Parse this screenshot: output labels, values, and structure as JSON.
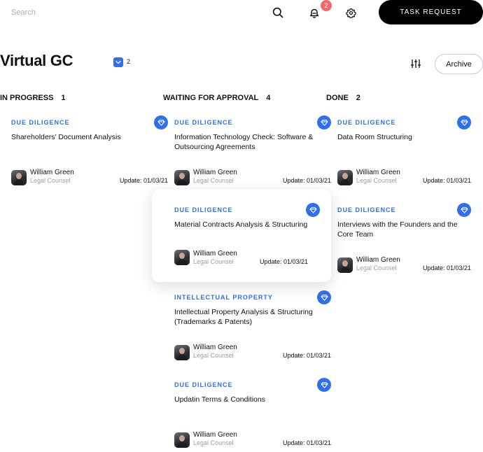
{
  "search": {
    "placeholder": "Search"
  },
  "header": {
    "notification_count": "2",
    "task_request_label": "TASK REQUEST"
  },
  "page": {
    "title": "Virtual GC",
    "selected_count": "2",
    "archive_label": "Archive"
  },
  "columns": [
    {
      "title": "IN PROGRESS",
      "count": "1",
      "cards": [
        {
          "category": "DUE DILIGENCE",
          "title": "Shareholders’ Document Analysis",
          "person": "William Green",
          "role": "Legal Counsel",
          "update": "Update: 01/03/21"
        }
      ]
    },
    {
      "title": "WAITING FOR APPROVAL",
      "count": "4",
      "cards": [
        {
          "category": "DUE DILIGENCE",
          "title": "Information Technology Check: Software & Outsourcing Agreements",
          "person": "William Green",
          "role": "Legal Counsel",
          "update": "Update: 01/03/21"
        },
        {
          "category": "DUE DILIGENCE",
          "title": "Material Contracts Analysis & Structuring",
          "person": "William Green",
          "role": "Legal Counsel",
          "update": "Update: 01/03/21"
        },
        {
          "category": "INTELLECTUAL PROPERTY",
          "title": "Intellectual Property Analysis & Structuring (Trademarks & Patents)",
          "person": "William Green",
          "role": "Legal Counsel",
          "update": "Update: 01/03/21"
        },
        {
          "category": "DUE DILIGENCE",
          "title": "Updatin Terms & Conditions",
          "person": "William Green",
          "role": "Legal Counsel",
          "update": "Update: 01/03/21"
        }
      ]
    },
    {
      "title": "DONE",
      "count": "2",
      "cards": [
        {
          "category": "DUE DILIGENCE",
          "title": "Data Room Structuring",
          "person": "William Green",
          "role": "Legal Counsel",
          "update": "Update: 01/03/21"
        },
        {
          "category": "DUE DILIGENCE",
          "title": "Interviews with the Founders and the Core Team",
          "person": "William Green",
          "role": "Legal Counsel",
          "update": "Update: 01/03/21"
        }
      ]
    }
  ],
  "icons": {
    "search": "search-icon",
    "notifications": "bell-icon",
    "settings": "gear-icon",
    "filter": "sliders-icon",
    "card_badge": "diamond-icon",
    "select": "chevron-down-icon"
  },
  "colors": {
    "accent": "#2f6fec",
    "badge": "#f06b6b",
    "primary_button": "#000000"
  }
}
